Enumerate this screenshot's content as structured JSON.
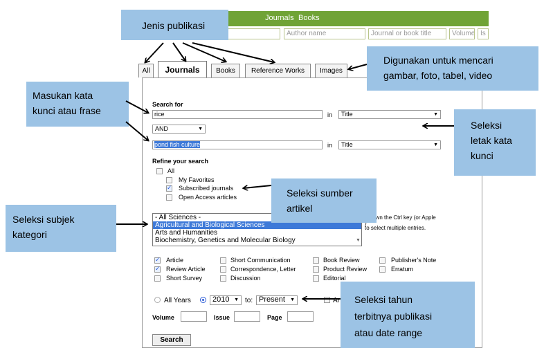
{
  "topnav": {
    "journals": "Journals",
    "books": "Books"
  },
  "quick_search": {
    "author_placeholder": "Author name",
    "journal_placeholder": "Journal or book title",
    "volume_placeholder": "Volume",
    "issue_placeholder": "Is"
  },
  "tabs": [
    {
      "label": "All",
      "active": false
    },
    {
      "label": "Journals",
      "active": true
    },
    {
      "label": "Books",
      "active": false
    },
    {
      "label": "Reference Works",
      "active": false
    },
    {
      "label": "Images",
      "active": false
    }
  ],
  "search": {
    "heading": "Search for",
    "term1": "rice",
    "in_label": "in",
    "field1": "Title",
    "operator": "AND",
    "term2": "pond fish culture",
    "field2": "Title"
  },
  "refine": {
    "heading": "Refine your search",
    "options": [
      {
        "label": "All",
        "checked": false
      },
      {
        "label": "My Favorites",
        "checked": false
      },
      {
        "label": "Subscribed journals",
        "checked": true
      },
      {
        "label": "Open Access articles",
        "checked": false
      }
    ]
  },
  "subjects": {
    "options": [
      "- All Sciences -",
      "Agricultural and Biological Sciences",
      "Arts and Humanities",
      "Biochemistry, Genetics and Molecular Biology"
    ],
    "selected_index": 1,
    "hint_line1": "d down the Ctrl key (or Apple",
    "hint_line2": ")",
    "hint_line3": "to select multiple entries."
  },
  "doc_types": [
    {
      "label": "Article",
      "checked": true
    },
    {
      "label": "Short Communication",
      "checked": false
    },
    {
      "label": "Book Review",
      "checked": false
    },
    {
      "label": "Publisher's Note",
      "checked": false
    },
    {
      "label": "Review Article",
      "checked": true
    },
    {
      "label": "Correspondence, Letter",
      "checked": false
    },
    {
      "label": "Product Review",
      "checked": false
    },
    {
      "label": "Erratum",
      "checked": false
    },
    {
      "label": "Short Survey",
      "checked": false
    },
    {
      "label": "Discussion",
      "checked": false
    },
    {
      "label": "Editorial",
      "checked": false
    }
  ],
  "date": {
    "all_years_label": "All Years",
    "from_year": "2010",
    "to_label": "to:",
    "to_value": "Present",
    "trailing": "Ar"
  },
  "biblio": {
    "volume_label": "Volume",
    "issue_label": "Issue",
    "page_label": "Page"
  },
  "search_button": "Search",
  "callouts": {
    "jenis": "Jenis publikasi",
    "gambar": [
      "Digunakan untuk mencari",
      "gambar, foto, tabel, video"
    ],
    "masukan": [
      "Masukan kata",
      "kunci atau frase"
    ],
    "letak": [
      "Seleksi",
      "letak kata",
      "kunci"
    ],
    "sumber": [
      "Seleksi sumber",
      "artikel"
    ],
    "subjek": [
      "Seleksi subjek",
      "kategori"
    ],
    "tahun": [
      "Seleksi tahun",
      "terbitnya publikasi",
      "atau date range"
    ]
  },
  "colors": {
    "header_green": "#70a336",
    "callout_blue": "#9cc3e5",
    "selection_blue": "#3d79d8"
  }
}
